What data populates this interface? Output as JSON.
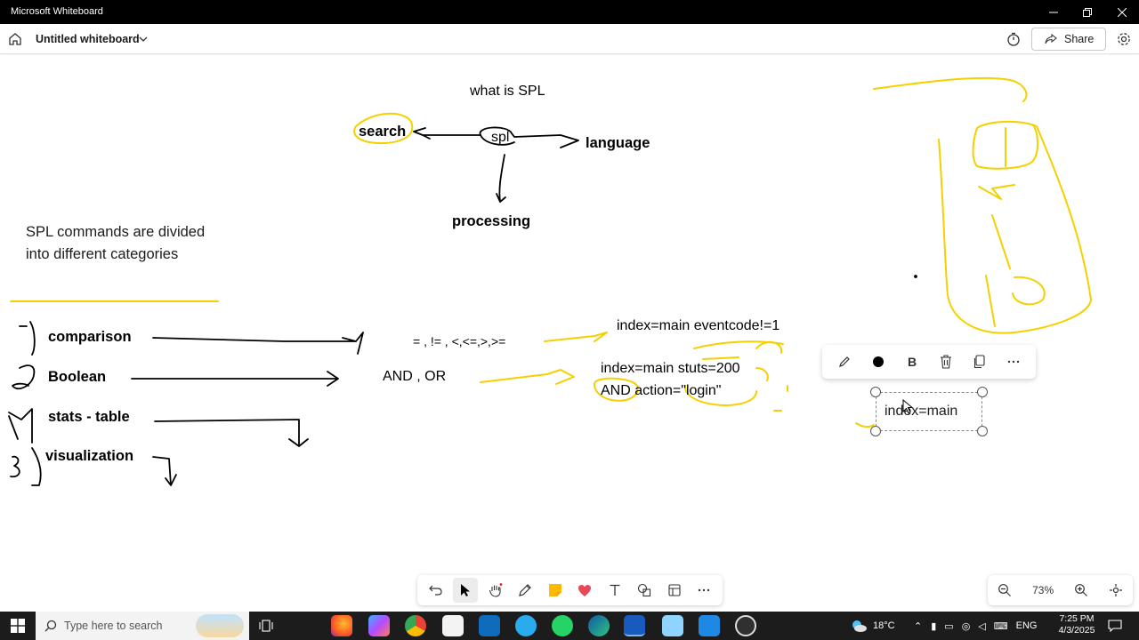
{
  "window": {
    "title": "Microsoft Whiteboard",
    "controls": [
      "minimize",
      "maximize",
      "close"
    ]
  },
  "header": {
    "board_title": "Untitled whiteboard",
    "share_label": "Share"
  },
  "canvas": {
    "heading": "what is SPL",
    "mindmap": {
      "center": "spl",
      "left": "search",
      "right": "language",
      "bottom": "processing"
    },
    "note": "SPL commands are divided into different categories",
    "categories": [
      "comparison",
      "Boolean",
      "stats - table",
      "visualization"
    ],
    "operators": "= , != , <,<=,>,>=",
    "boolean_ops": "AND , OR",
    "example1": "index=main  eventcode!=1",
    "example2_line1": "index=main stuts=200",
    "example2_line2": "AND action=\"login\"",
    "selected_text": "index=main"
  },
  "context_toolbar": {
    "items": [
      "pen-icon",
      "color-icon",
      "bold-icon",
      "delete-icon",
      "copy-icon",
      "more-icon"
    ]
  },
  "toolbar": {
    "items": [
      "undo",
      "select",
      "hand",
      "pen",
      "sticky-note",
      "reactions",
      "text",
      "shapes",
      "templates",
      "more"
    ]
  },
  "zoom": {
    "level": "73%"
  },
  "taskbar": {
    "search_placeholder": "Type here to search",
    "weather": "18°C",
    "language": "ENG",
    "time": "7:25 PM",
    "date": "4/3/2025"
  },
  "colors": {
    "ink_yellow": "#f5d000",
    "ink_black": "#000000",
    "titlebar": "#000000",
    "taskbar": "#1c1c1c"
  }
}
